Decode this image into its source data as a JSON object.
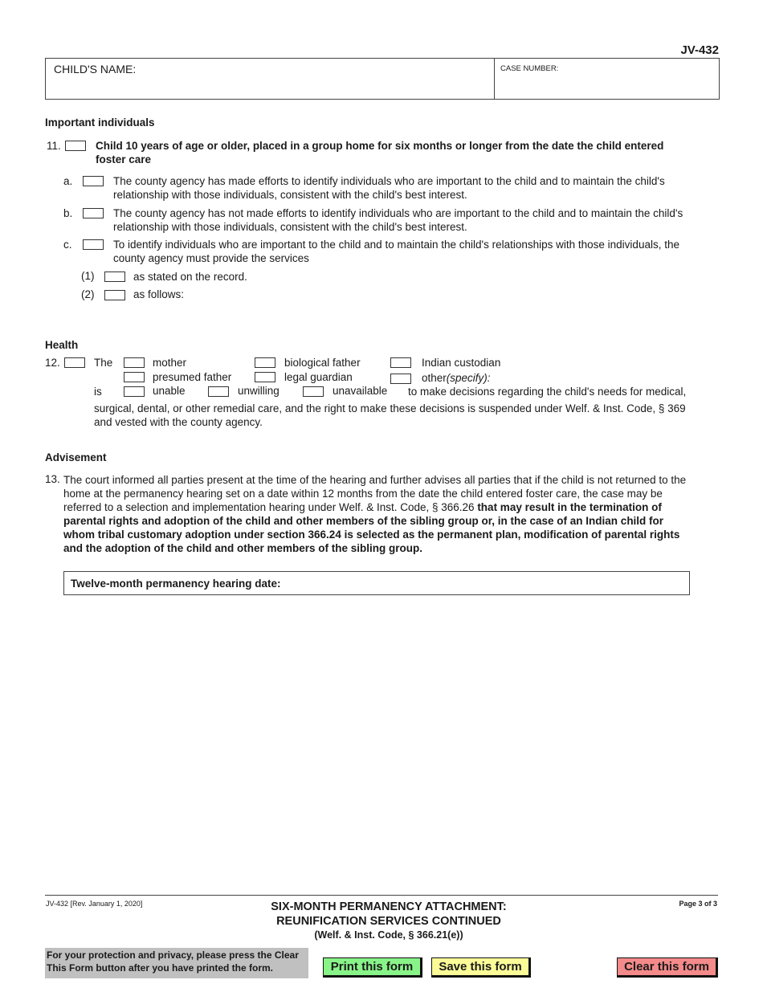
{
  "form": {
    "number": "JV-432",
    "child_name_label": "CHILD'S NAME:",
    "case_number_label": "CASE NUMBER:"
  },
  "sections": {
    "important": {
      "heading": "Important individuals",
      "item11": {
        "number": "11.",
        "text_line1": "Child 10 years of age or older, placed in a group home for six months or longer from the date the child entered",
        "text_line2": "foster care",
        "a": {
          "letter": "a.",
          "line1": "The county agency has made efforts to identify individuals who are important to the child and to maintain the child's",
          "line2": "relationship with those individuals, consistent with the child's best interest."
        },
        "b": {
          "letter": "b.",
          "line1": "The county agency has not made efforts to identify individuals who are important to the child and to maintain the child's",
          "line2": "relationship with those individuals, consistent with the child's best interest."
        },
        "c": {
          "letter": "c.",
          "line1": "To identify individuals who are important to the child and to maintain the child's relationships with those individuals, the",
          "line2": "county agency must provide the services",
          "opt1": {
            "num": "(1)",
            "label": "as stated on the record."
          },
          "opt2": {
            "num": "(2)",
            "label": "as follows:"
          }
        }
      }
    },
    "health": {
      "heading": "Health",
      "number": "12.",
      "the": "The",
      "is": "is",
      "parties": [
        "mother",
        "biological father",
        "Indian custodian",
        "presumed father",
        "legal guardian",
        "other"
      ],
      "specify": "(specify):",
      "conditions": [
        "unable",
        "unwilling",
        "unavailable"
      ],
      "text_line1": "to make decisions regarding the child's needs for medical,",
      "text_line2": "surgical, dental, or other remedial care, and the right to make these decisions is suspended under Welf. & Inst. Code, § 369",
      "text_line3": "and vested with the county agency."
    },
    "advisement": {
      "heading": "Advisement",
      "number": "13.",
      "line1": "The court informed all parties present at the time of the hearing and further advises all parties that if the child is not returned to the",
      "line2": "home at the permanency hearing set on a date within 12 months from the date the child entered foster care, the case may be",
      "line3_normal": "referred to a selection and implementation hearing under Welf. & Inst. Code, § 366.26 ",
      "line3_bold": "that may result in the termination of",
      "line4": "parental rights and adoption of the child and other members of the sibling group or, in the case of an Indian child for",
      "line5": "whom tribal customary adoption under section 366.24 is selected as the permanent plan, modification of parental rights",
      "line6": "and the adoption of the child and other members of the sibling group.",
      "date_label": "Twelve-month permanency hearing date:"
    }
  },
  "footer": {
    "revision": "JV-432 [Rev. January 1, 2020]",
    "title_line1": "SIX-MONTH PERMANENCY ATTACHMENT:",
    "title_line2": "REUNIFICATION SERVICES CONTINUED",
    "subtitle": "(Welf. & Inst. Code, § 366.21(e))",
    "page": "Page 3 of 3",
    "privacy_line1": "For your protection and privacy, please press the Clear",
    "privacy_line2": "This Form button after you have printed the form.",
    "buttons": {
      "print": "Print this form",
      "save": "Save this form",
      "clear": "Clear this form"
    },
    "colors": {
      "print": "#88f488",
      "save": "#fbfb98",
      "clear": "#f48a8a",
      "privacy_bg": "#c0c0c0"
    }
  }
}
